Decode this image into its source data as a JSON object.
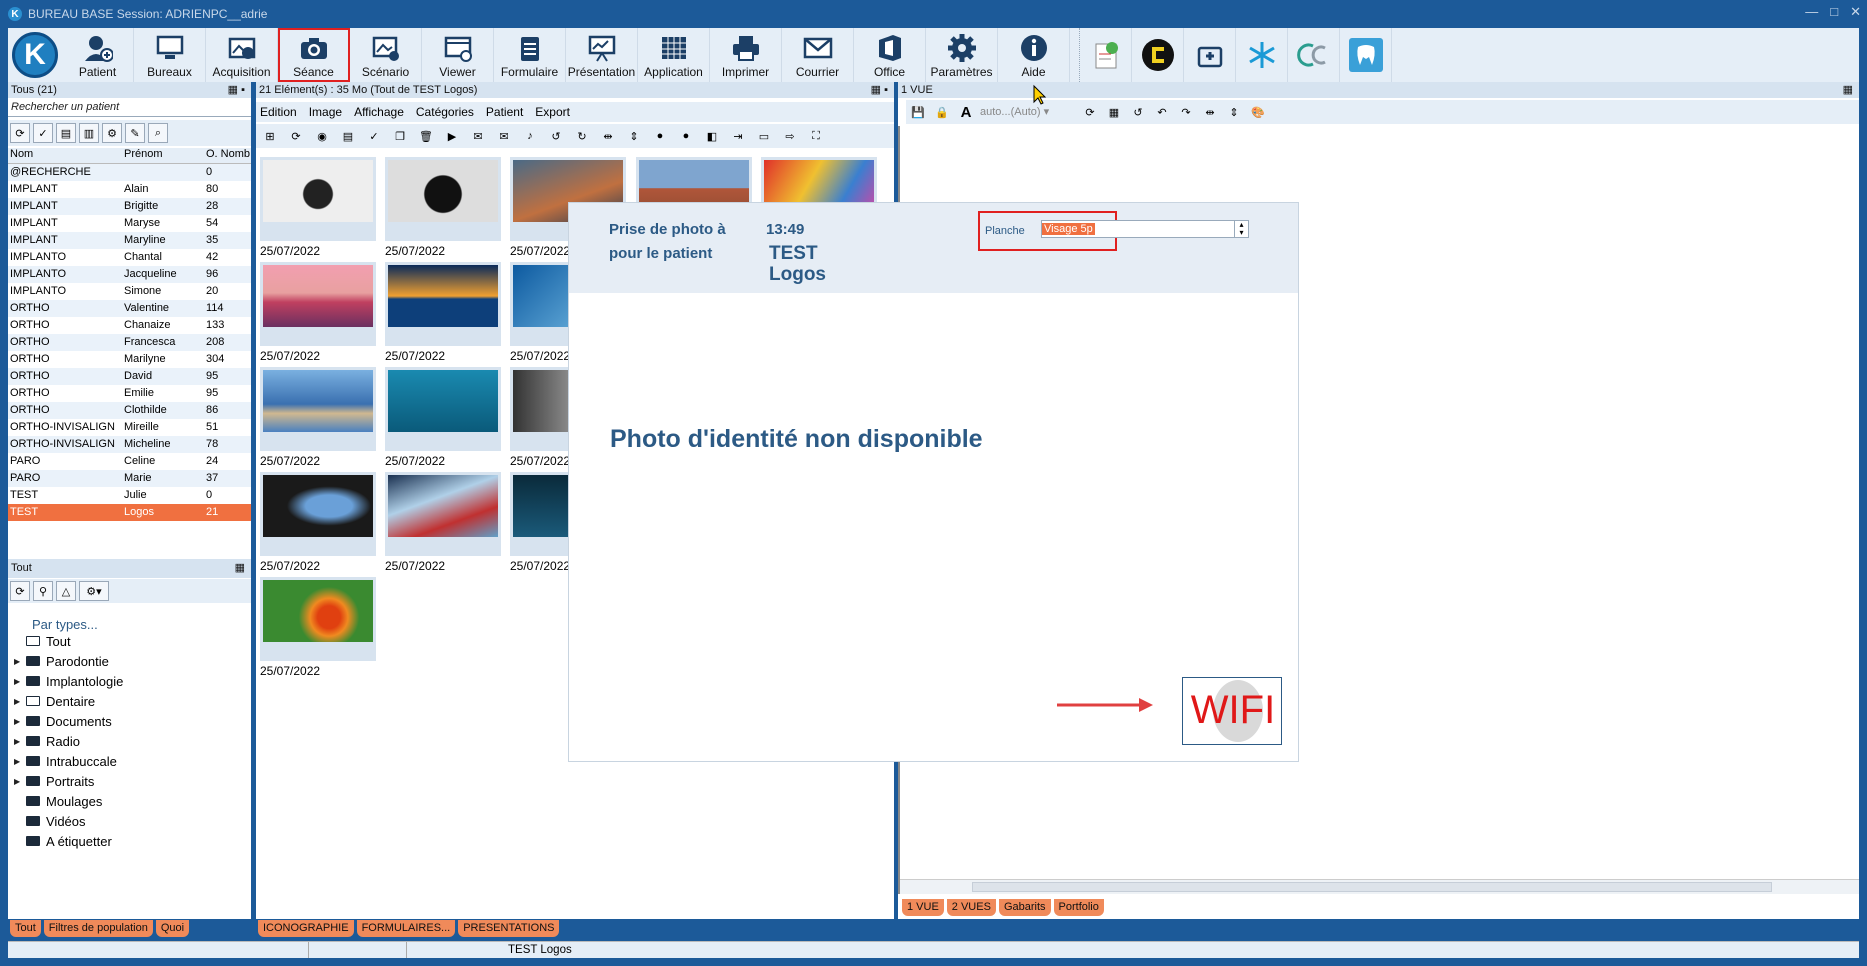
{
  "window": {
    "title": "BUREAU BASE Session: ADRIENPC__adrie",
    "controls": [
      "—",
      "□",
      "✕"
    ]
  },
  "ribbon": {
    "buttons": [
      {
        "label": "Patient",
        "icon": "add-user-icon"
      },
      {
        "label": "Bureaux",
        "icon": "desktop-icon"
      },
      {
        "label": "Acquisition",
        "icon": "image-import-icon"
      },
      {
        "label": "Séance",
        "icon": "camera-icon"
      },
      {
        "label": "Scénario",
        "icon": "scenario-icon"
      },
      {
        "label": "Viewer",
        "icon": "viewer-icon"
      },
      {
        "label": "Formulaire",
        "icon": "clipboard-icon"
      },
      {
        "label": "Présentation",
        "icon": "presentation-icon"
      },
      {
        "label": "Application",
        "icon": "grid-icon"
      },
      {
        "label": "Imprimer",
        "icon": "printer-icon"
      },
      {
        "label": "Courrier",
        "icon": "mail-icon"
      },
      {
        "label": "Office",
        "icon": "office-icon"
      },
      {
        "label": "Paramètres",
        "icon": "gear-icon"
      },
      {
        "label": "Aide",
        "icon": "info-icon"
      }
    ]
  },
  "patients": {
    "header": "Tous (21)",
    "search_placeholder": "Rechercher un patient",
    "columns": [
      "Nom",
      "Prénom",
      "O. Nomb"
    ],
    "rows": [
      {
        "nom": "@RECHERCHE",
        "prenom": "",
        "n": "0"
      },
      {
        "nom": "IMPLANT",
        "prenom": "Alain",
        "n": "80"
      },
      {
        "nom": "IMPLANT",
        "prenom": "Brigitte",
        "n": "28"
      },
      {
        "nom": "IMPLANT",
        "prenom": "Maryse",
        "n": "54"
      },
      {
        "nom": "IMPLANT",
        "prenom": "Maryline",
        "n": "35"
      },
      {
        "nom": "IMPLANTO",
        "prenom": "Chantal",
        "n": "42"
      },
      {
        "nom": "IMPLANTO",
        "prenom": "Jacqueline",
        "n": "96"
      },
      {
        "nom": "IMPLANTO",
        "prenom": "Simone",
        "n": "20"
      },
      {
        "nom": "ORTHO",
        "prenom": "Valentine",
        "n": "114"
      },
      {
        "nom": "ORTHO",
        "prenom": "Chanaize",
        "n": "133"
      },
      {
        "nom": "ORTHO",
        "prenom": "Francesca",
        "n": "208"
      },
      {
        "nom": "ORTHO",
        "prenom": "Marilyne",
        "n": "304"
      },
      {
        "nom": "ORTHO",
        "prenom": "David",
        "n": "95"
      },
      {
        "nom": "ORTHO",
        "prenom": "Emilie",
        "n": "95"
      },
      {
        "nom": "ORTHO",
        "prenom": "Clothilde",
        "n": "86"
      },
      {
        "nom": "ORTHO-INVISALIGN",
        "prenom": "Mireille",
        "n": "51"
      },
      {
        "nom": "ORTHO-INVISALIGN",
        "prenom": "Micheline",
        "n": "78"
      },
      {
        "nom": "PARO",
        "prenom": "Celine",
        "n": "24"
      },
      {
        "nom": "PARO",
        "prenom": "Marie",
        "n": "37"
      },
      {
        "nom": "TEST",
        "prenom": "Julie",
        "n": "0"
      },
      {
        "nom": "TEST",
        "prenom": "Logos",
        "n": "21"
      }
    ],
    "selected_index": 20
  },
  "types": {
    "header": "Tout",
    "par_types": "Par types...",
    "tree": [
      {
        "label": "Tout",
        "open": true,
        "arrow": false
      },
      {
        "label": "Parodontie",
        "open": false,
        "arrow": true
      },
      {
        "label": "Implantologie",
        "open": false,
        "arrow": true
      },
      {
        "label": "Dentaire",
        "open": true,
        "arrow": true
      },
      {
        "label": "Documents",
        "open": false,
        "arrow": true
      },
      {
        "label": "Radio",
        "open": false,
        "arrow": true
      },
      {
        "label": "Intrabuccale",
        "open": false,
        "arrow": true
      },
      {
        "label": "Portraits",
        "open": false,
        "arrow": true
      },
      {
        "label": "Moulages",
        "open": false,
        "arrow": false
      },
      {
        "label": "Vidéos",
        "open": false,
        "arrow": false
      },
      {
        "label": "A étiquetter",
        "open": false,
        "arrow": false
      }
    ],
    "tabs": [
      "Tout",
      "Filtres de population",
      "Quoi"
    ]
  },
  "media": {
    "header": "21 Elément(s) : 35 Mo (Tout de TEST Logos)",
    "menu": [
      "Edition",
      "Image",
      "Affichage",
      "Catégories",
      "Patient",
      "Export"
    ],
    "thumb_date": "25/07/2022",
    "tabs": [
      "ICONOGRAPHIE",
      "FORMULAIRES...",
      "PRESENTATIONS"
    ]
  },
  "viewer": {
    "header": "1 VUE",
    "auto_label": "auto...(Auto)",
    "tabs": [
      "1 VUE",
      "2 VUES",
      "Gabarits",
      "Portfolio"
    ]
  },
  "seance": {
    "line1": "Prise de photo à",
    "line2": "pour le patient",
    "time": "13:49",
    "patient_first": "TEST",
    "patient_last": "Logos",
    "planche_label": "Planche",
    "planche_value": "Visage 5p",
    "no_photo": "Photo d'identité non disponible",
    "wifi": "WIFI"
  },
  "status": {
    "patient": "TEST Logos"
  },
  "colors": {
    "accent": "#f07040",
    "title": "#1c5a99",
    "ribbon": "#e5eef7",
    "heading": "#2c5a85"
  }
}
